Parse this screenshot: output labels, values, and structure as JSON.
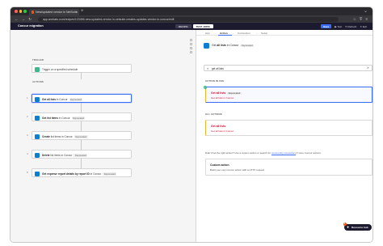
{
  "browser": {
    "tab_title": "New/updated vendor in NetSuite",
    "tab_close": "×",
    "new_tab": "+",
    "tab_menu": "⌄",
    "url": "app.workato.com/recipes/123456-new-updated-vendor-in-netsuite-creates-updates-vendor-in-concur/edit",
    "nav": {
      "back": "←",
      "forward": "→",
      "reload": "↻"
    },
    "icons": {
      "star": "☆",
      "shield": "⛨",
      "menu": "≡"
    }
  },
  "app_header": {
    "title": "Concur migration",
    "toggles": [
      "RECIPE",
      "TEST JOBS"
    ],
    "active_toggle": "RECIPE",
    "save_label": "Save",
    "test_label": "▶ Test",
    "refresh_label": "↻ Refresh",
    "exit_label": "✕ Exit"
  },
  "canvas": {
    "trigger_section": "TRIGGER",
    "actions_section": "ACTIONS",
    "trigger_step": {
      "text": "Trigger on a specified schedule"
    },
    "steps": [
      {
        "num": "1",
        "verb": "Get all lists",
        "suffix": " in Concur",
        "badge": "Deprecated"
      },
      {
        "num": "2",
        "verb": "Get list items",
        "suffix": " in Concur",
        "badge": "Deprecated"
      },
      {
        "num": "3",
        "verb": "Create",
        "suffix": " list items in Concur",
        "badge": "Deprecated"
      },
      {
        "num": "4",
        "verb": "Delete",
        "suffix": " list items in Concur",
        "badge": "Deprecated"
      },
      {
        "num": "5",
        "verb": "Get expense report details by report ID",
        "suffix": " in Concur",
        "badge": "Deprecated"
      }
    ]
  },
  "editor": {
    "tabs": [
      "App",
      "Action",
      "Connection",
      "Setup"
    ],
    "active_tab": "Action",
    "tab_separator": "→",
    "app_head": {
      "prefix": "Get ",
      "bold": "all lists",
      "suffix": " in Concur",
      "badge": "Deprecated"
    },
    "search": {
      "value": "get all lists",
      "icon": "⌕",
      "clear": "✕"
    },
    "action_in_use_label": "ACTION IN USE",
    "all_actions_label": "ALL ACTIONS",
    "action_in_use": {
      "title": "Get all lists",
      "badge": "Deprecated",
      "desc": "Get all lists in Concur",
      "check": "✓"
    },
    "all_action": {
      "title": "Get all lists",
      "desc": "Get all lists in Concur"
    },
    "hint_prefix": "Didn't find the right action? Use a custom action or search for ",
    "hint_link": "community connectors",
    "hint_suffix": " if more Concur actions.",
    "custom": {
      "title": "Custom action",
      "desc": "Build your own Concur action with a HTTP request"
    },
    "hub": {
      "label": "Resource hub",
      "icon": "✚",
      "count": "3"
    }
  },
  "colors": {
    "accent": "#3b6cf5",
    "header_bg": "#1c1a2e",
    "concur": "#0b7fd4",
    "deprecated_text": "#c8102e",
    "warning_stripe": "#f0b429",
    "success": "#3bb98a"
  }
}
